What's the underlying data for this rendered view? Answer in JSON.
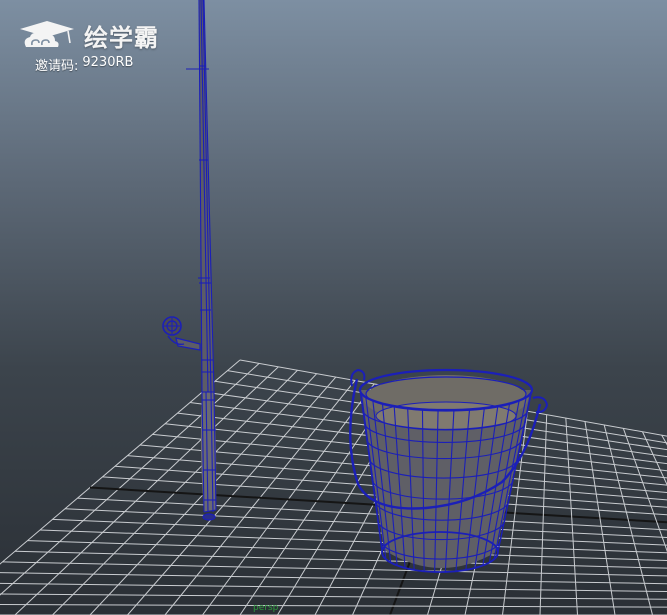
{
  "viewport": {
    "camera_label": "persp",
    "background_top": "#7d8fa2",
    "background_bottom": "#2a2f35",
    "grid_color": "#c9ccd0",
    "axis_color": "#151515",
    "wireframe_color": "#1b1fb8",
    "mesh_color": "#5f5f66"
  },
  "watermark": {
    "logo_icon": "cloud-mortarboard-icon",
    "brand": "绘学霸",
    "invite_label": "邀请码:",
    "invite_code": "9230RB"
  },
  "objects": [
    {
      "name": "fishing-rod",
      "mode": "wireframe-on-shaded"
    },
    {
      "name": "bucket",
      "mode": "wireframe-on-shaded"
    }
  ]
}
